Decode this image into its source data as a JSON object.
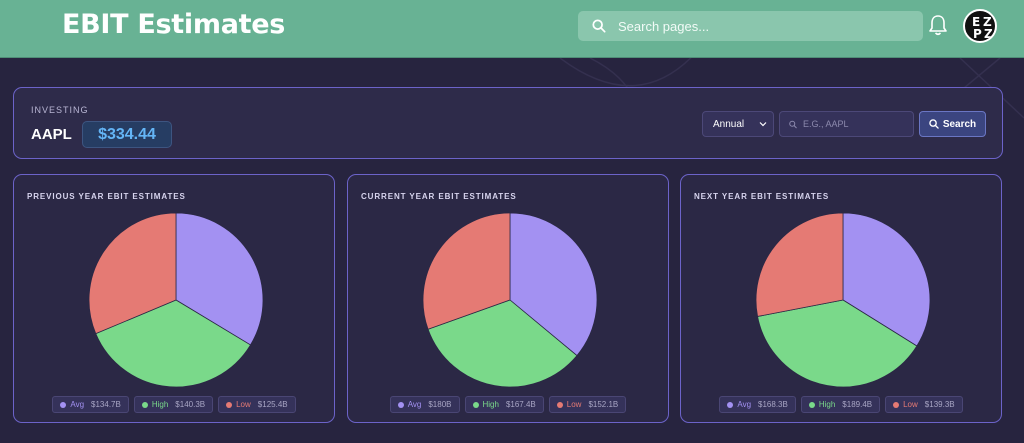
{
  "header": {
    "title": "EBIT Estimates",
    "search_placeholder": "Search pages...",
    "avatar_text": [
      "E",
      "Z",
      "P",
      "Z"
    ]
  },
  "ticker_panel": {
    "section_label": "INVESTING",
    "ticker": "AAPL",
    "price": "$334.44",
    "period": "Annual",
    "ticker_placeholder": "E.G., AAPL",
    "search_label": "Search"
  },
  "colors": {
    "avg": "#a391f2",
    "high": "#7ad98a",
    "low": "#e57a74",
    "accent": "#6c63c9",
    "header": "#68b294",
    "price": "#64b5f6"
  },
  "cards": [
    {
      "title": "PREVIOUS YEAR EBIT ESTIMATES",
      "legend": [
        {
          "name": "Avg",
          "value": "$134.7B"
        },
        {
          "name": "High",
          "value": "$140.3B"
        },
        {
          "name": "Low",
          "value": "$125.4B"
        }
      ]
    },
    {
      "title": "CURRENT YEAR EBIT ESTIMATES",
      "legend": [
        {
          "name": "Avg",
          "value": "$180B"
        },
        {
          "name": "High",
          "value": "$167.4B"
        },
        {
          "name": "Low",
          "value": "$152.1B"
        }
      ]
    },
    {
      "title": "NEXT YEAR EBIT ESTIMATES",
      "legend": [
        {
          "name": "Avg",
          "value": "$168.3B"
        },
        {
          "name": "High",
          "value": "$189.4B"
        },
        {
          "name": "Low",
          "value": "$139.3B"
        }
      ]
    }
  ],
  "chart_data": [
    {
      "type": "pie",
      "title": "PREVIOUS YEAR EBIT ESTIMATES",
      "categories": [
        "Avg",
        "High",
        "Low"
      ],
      "values": [
        134.7,
        140.3,
        125.4
      ]
    },
    {
      "type": "pie",
      "title": "CURRENT YEAR EBIT ESTIMATES",
      "categories": [
        "Avg",
        "High",
        "Low"
      ],
      "values": [
        180,
        167.4,
        152.1
      ]
    },
    {
      "type": "pie",
      "title": "NEXT YEAR EBIT ESTIMATES",
      "categories": [
        "Avg",
        "High",
        "Low"
      ],
      "values": [
        168.3,
        189.4,
        139.3
      ]
    }
  ]
}
